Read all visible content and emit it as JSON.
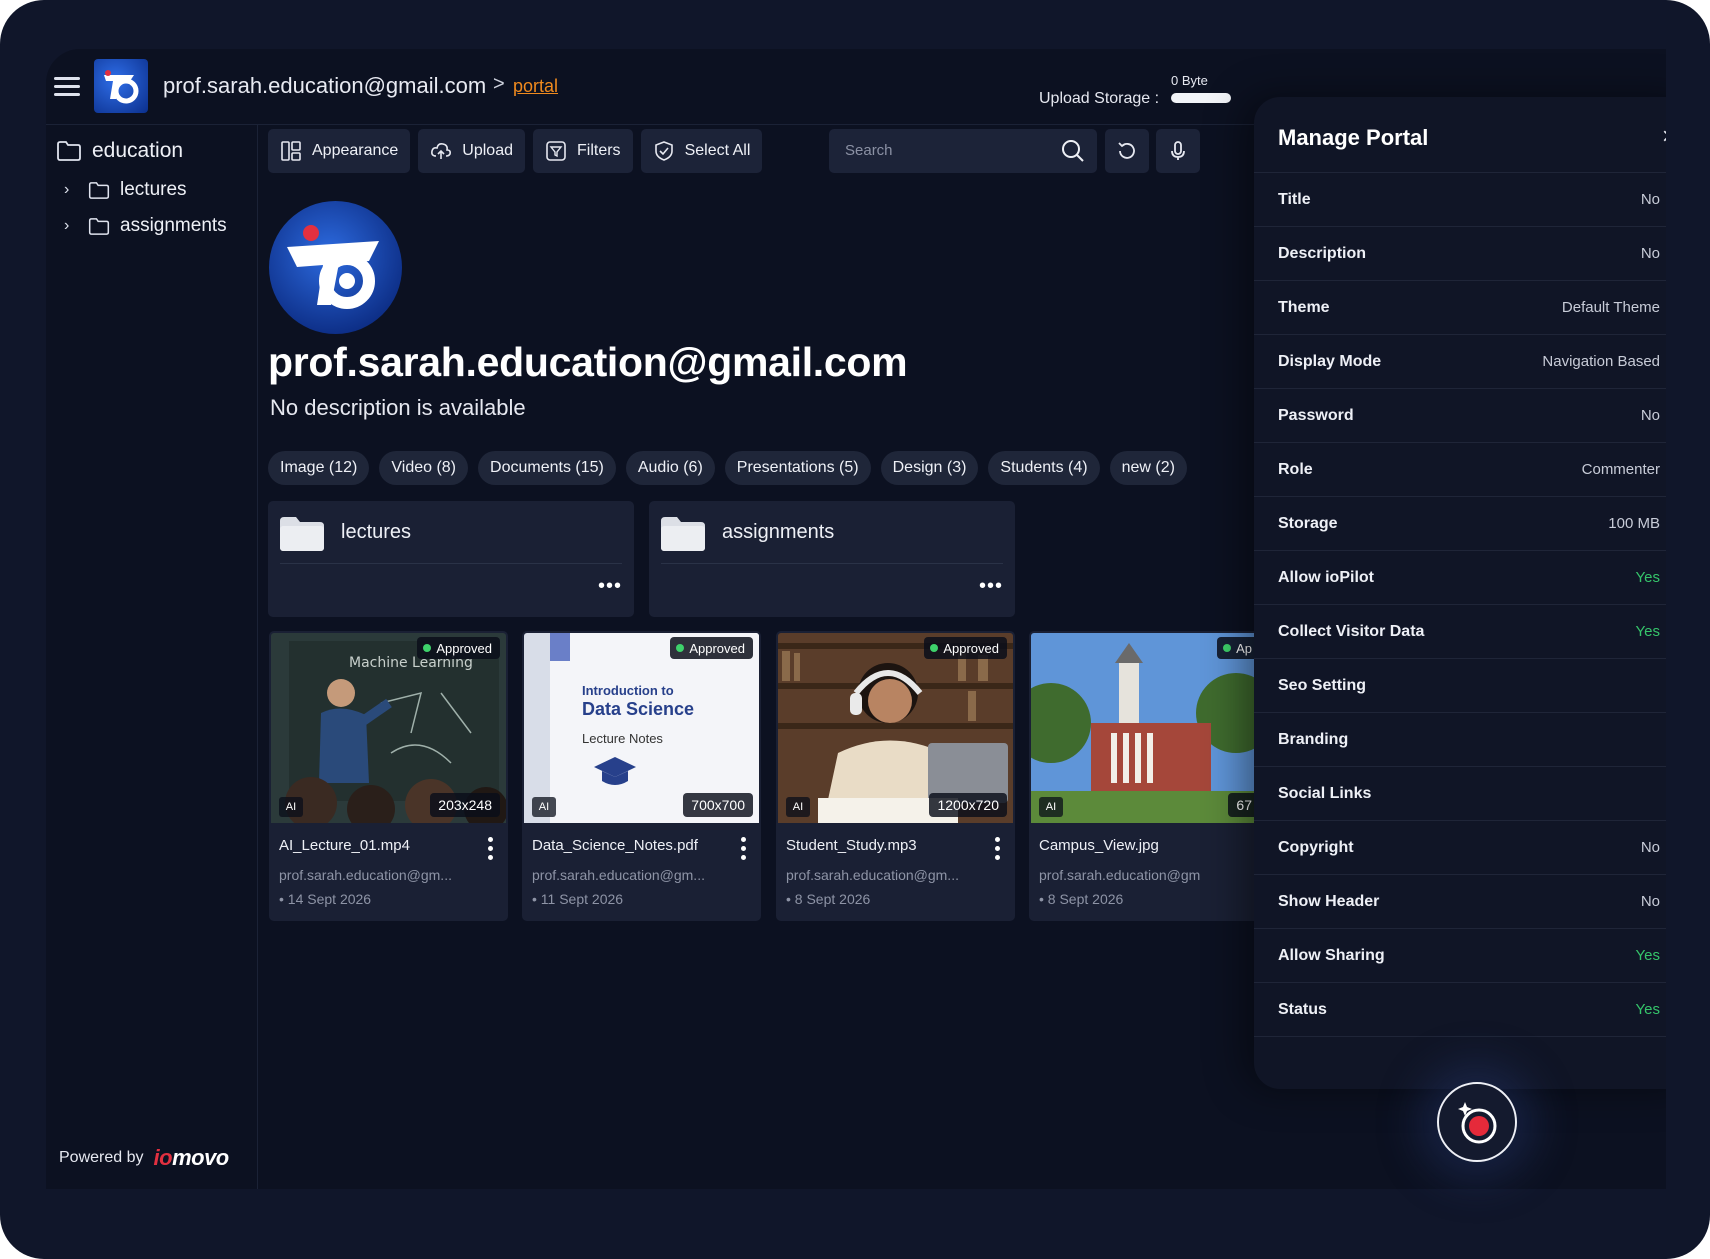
{
  "header": {
    "email": "prof.sarah.education@gmail.com",
    "separator": ">",
    "current_link": "portal",
    "storage_value": "0 Byte",
    "storage_label": "Upload Storage :"
  },
  "sidebar": {
    "root": "education",
    "children": [
      {
        "label": "lectures"
      },
      {
        "label": "assignments"
      }
    ],
    "powered_by": "Powered by",
    "brand": "iomovo"
  },
  "toolbar": {
    "appearance": "Appearance",
    "upload": "Upload",
    "filters": "Filters",
    "select_all": "Select All",
    "search_placeholder": "Search"
  },
  "profile": {
    "name": "prof.sarah.education@gmail.com",
    "description": "No description is available"
  },
  "chips": [
    "Image (12)",
    "Video (8)",
    "Documents (15)",
    "Audio (6)",
    "Presentations (5)",
    "Design (3)",
    "Students (4)",
    "new (2)"
  ],
  "folders": [
    {
      "name": "lectures",
      "menu": "•••"
    },
    {
      "name": "assignments",
      "menu": "•••"
    }
  ],
  "files": [
    {
      "name": "AI_Lecture_01.mp4",
      "owner": "prof.sarah.education@gm...",
      "date": "14 Sept 2026",
      "status": "Approved",
      "ai": "AI",
      "dims": "203x248"
    },
    {
      "name": "Data_Science_Notes.pdf",
      "owner": "prof.sarah.education@gm...",
      "date": "11 Sept 2026",
      "status": "Approved",
      "ai": "AI",
      "dims": "700x700",
      "doc_title_1": "Introduction to",
      "doc_title_2": "Data Science",
      "doc_sub": "Lecture Notes"
    },
    {
      "name": "Student_Study.mp3",
      "owner": "prof.sarah.education@gm...",
      "date": "8 Sept 2026",
      "status": "Approved",
      "ai": "AI",
      "dims": "1200x720"
    },
    {
      "name": "Campus_View.jpg",
      "owner": "prof.sarah.education@gm",
      "date": "8 Sept 2026",
      "status": "Ap",
      "ai": "AI",
      "dims": "67"
    }
  ],
  "board_text": "Machine Learning",
  "panel": {
    "title": "Manage Portal",
    "close": "×",
    "rows": [
      {
        "label": "Title",
        "value": "No"
      },
      {
        "label": "Description",
        "value": "No"
      },
      {
        "label": "Theme",
        "value": "Default Theme"
      },
      {
        "label": "Display Mode",
        "value": "Navigation Based"
      },
      {
        "label": "Password",
        "value": "No"
      },
      {
        "label": "Role",
        "value": "Commenter"
      },
      {
        "label": "Storage",
        "value": "100 MB"
      },
      {
        "label": "Allow ioPilot",
        "value": "Yes"
      },
      {
        "label": "Collect Visitor Data",
        "value": "Yes"
      },
      {
        "label": "Seo Setting",
        "value": ""
      },
      {
        "label": "Branding",
        "value": ""
      },
      {
        "label": "Social Links",
        "value": ""
      },
      {
        "label": "Copyright",
        "value": "No"
      },
      {
        "label": "Show Header",
        "value": "No"
      },
      {
        "label": "Allow Sharing",
        "value": "Yes"
      },
      {
        "label": "Status",
        "value": "Yes"
      }
    ]
  },
  "colors": {
    "accent": "#f08a1e",
    "yes": "#35c46a",
    "brand_red": "#e23040",
    "bg": "#0c1121"
  }
}
